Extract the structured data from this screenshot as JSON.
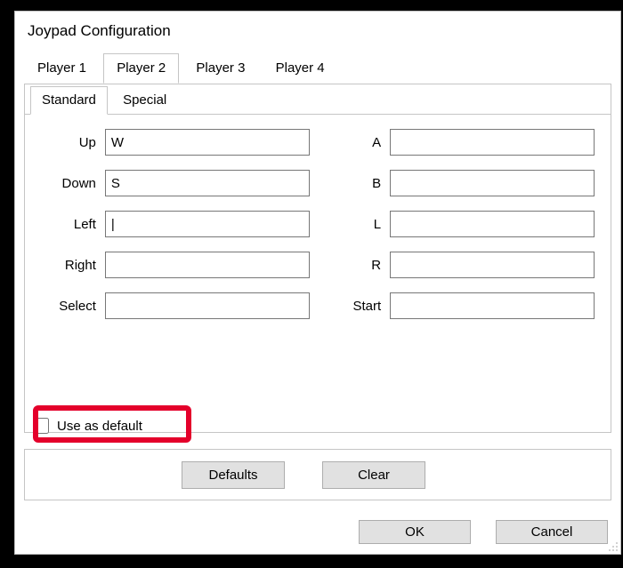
{
  "window": {
    "title": "Joypad Configuration"
  },
  "playerTabs": {
    "items": [
      {
        "label": "Player 1"
      },
      {
        "label": "Player 2"
      },
      {
        "label": "Player 3"
      },
      {
        "label": "Player 4"
      }
    ],
    "activeIndex": 1
  },
  "modeTabs": {
    "items": [
      {
        "label": "Standard"
      },
      {
        "label": "Special"
      }
    ],
    "activeIndex": 0
  },
  "bindings": {
    "left": [
      {
        "label": "Up",
        "value": "W"
      },
      {
        "label": "Down",
        "value": "S"
      },
      {
        "label": "Left",
        "value": "|"
      },
      {
        "label": "Right",
        "value": ""
      },
      {
        "label": "Select",
        "value": ""
      }
    ],
    "right": [
      {
        "label": "A",
        "value": ""
      },
      {
        "label": "B",
        "value": ""
      },
      {
        "label": "L",
        "value": ""
      },
      {
        "label": "R",
        "value": ""
      },
      {
        "label": "Start",
        "value": ""
      }
    ]
  },
  "useDefault": {
    "label": "Use as default",
    "checked": false
  },
  "buttons": {
    "defaults": "Defaults",
    "clear": "Clear",
    "ok": "OK",
    "cancel": "Cancel"
  }
}
